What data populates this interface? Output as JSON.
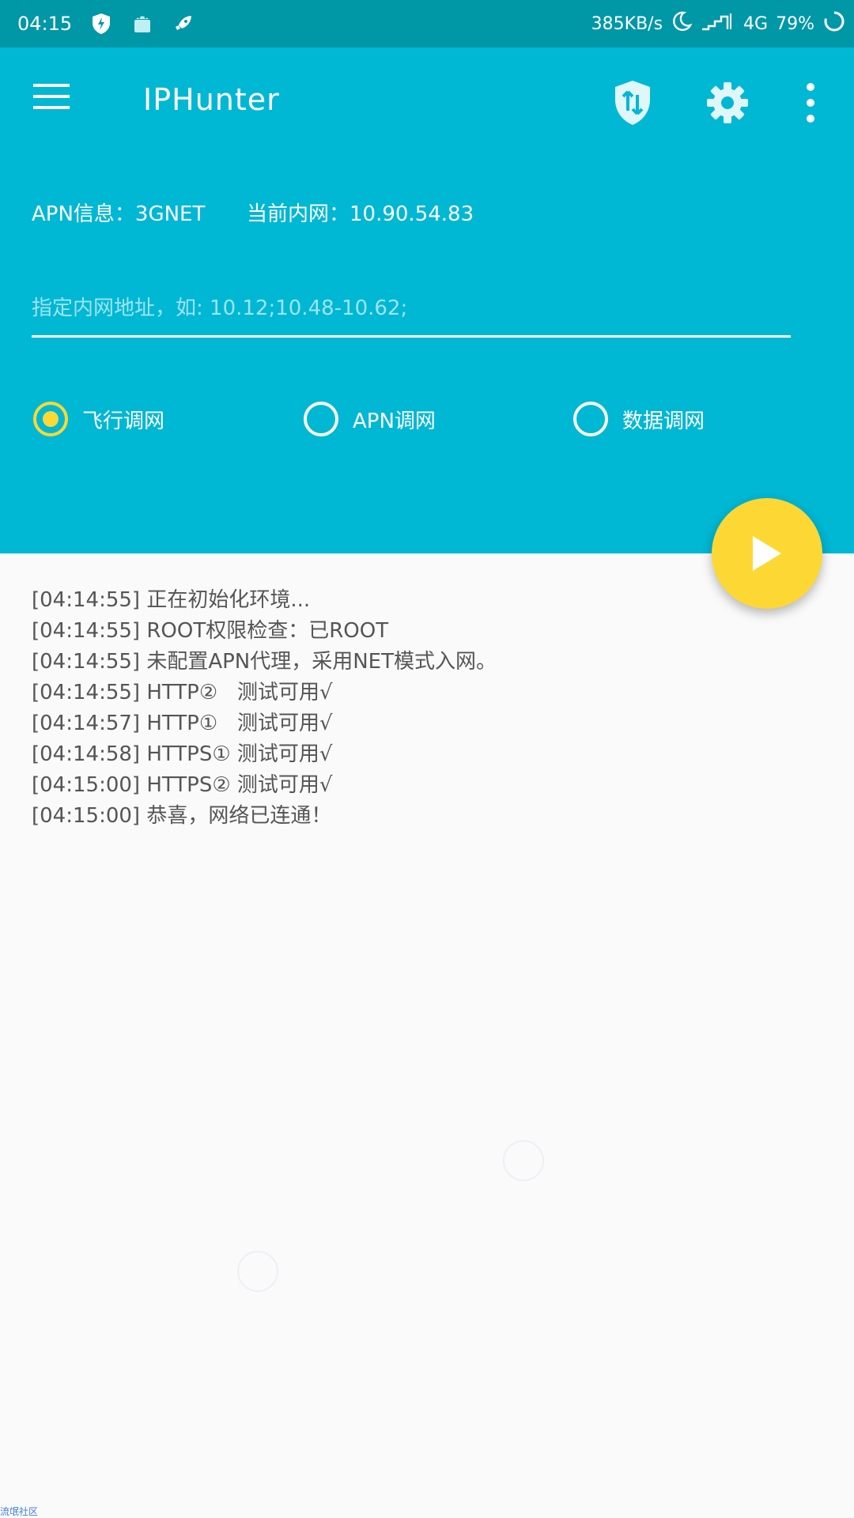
{
  "status_bar": {
    "time": "04:15",
    "net_speed": "385KB/s",
    "network_type": "4G",
    "battery": "79%",
    "icons": [
      "shield-bolt-icon",
      "android-icon",
      "rocket-icon",
      "moon-icon",
      "signal-icon",
      "battery-ring-icon"
    ]
  },
  "toolbar": {
    "title": "IPHunter",
    "icons": [
      "menu-icon",
      "shield-arrows-icon",
      "gear-icon",
      "more-vert-icon"
    ]
  },
  "info": {
    "apn": "APN信息：3GNET",
    "intranet": "当前内网：10.90.54.83"
  },
  "ip_input": {
    "placeholder": "指定内网地址，如: 10.12;10.48-10.62;",
    "value": ""
  },
  "modes": [
    {
      "label": "飞行调网",
      "checked": true
    },
    {
      "label": "APN调网",
      "checked": false
    },
    {
      "label": "数据调网",
      "checked": false
    }
  ],
  "fab": {
    "icon": "play-icon"
  },
  "log": [
    "[04:14:55] 正在初始化环境...",
    "[04:14:55] ROOT权限检查：已ROOT",
    "[04:14:55] 未配置APN代理，采用NET模式入网。",
    "[04:14:55] HTTP②   测试可用√",
    "[04:14:57] HTTP①   测试可用√",
    "[04:14:58] HTTPS① 测试可用√",
    "[04:15:00] HTTPS② 测试可用√",
    "[04:15:00] 恭喜，网络已连通！"
  ],
  "watermark": "流氓社区",
  "colors": {
    "primary": "#00b7d4",
    "status_bar": "#0097a7",
    "accent": "#fdd835",
    "background": "#fafafa",
    "log_text": "#555555"
  }
}
